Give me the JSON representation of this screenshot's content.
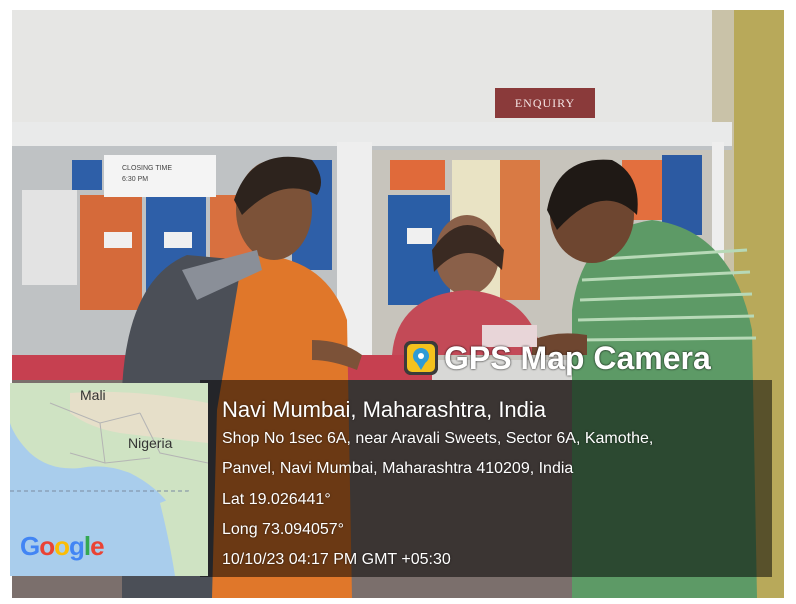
{
  "signs": {
    "enquiry": "ENQUIRY",
    "closing_time": "CLOSING TIME",
    "closing_hour": "6:30 PM"
  },
  "stamp": {
    "app_name": "GPS Map Camera",
    "place": "Navi Mumbai, Maharashtra, India",
    "address_line1": "Shop No 1sec 6A, near Aravali Sweets, Sector 6A, Kamothe,",
    "address_line2": "Panvel, Navi Mumbai, Maharashtra 410209, India",
    "lat": "Lat 19.026441°",
    "long": "Long 73.094057°",
    "datetime": "10/10/23 04:17 PM GMT +05:30"
  },
  "map": {
    "label_mali": "Mali",
    "label_nigeria": "Nigeria",
    "provider_letters": [
      "G",
      "o",
      "o",
      "g",
      "l",
      "e"
    ],
    "provider_colors": [
      "#4285F4",
      "#EA4335",
      "#FBBC05",
      "#4285F4",
      "#34A853",
      "#EA4335"
    ]
  }
}
